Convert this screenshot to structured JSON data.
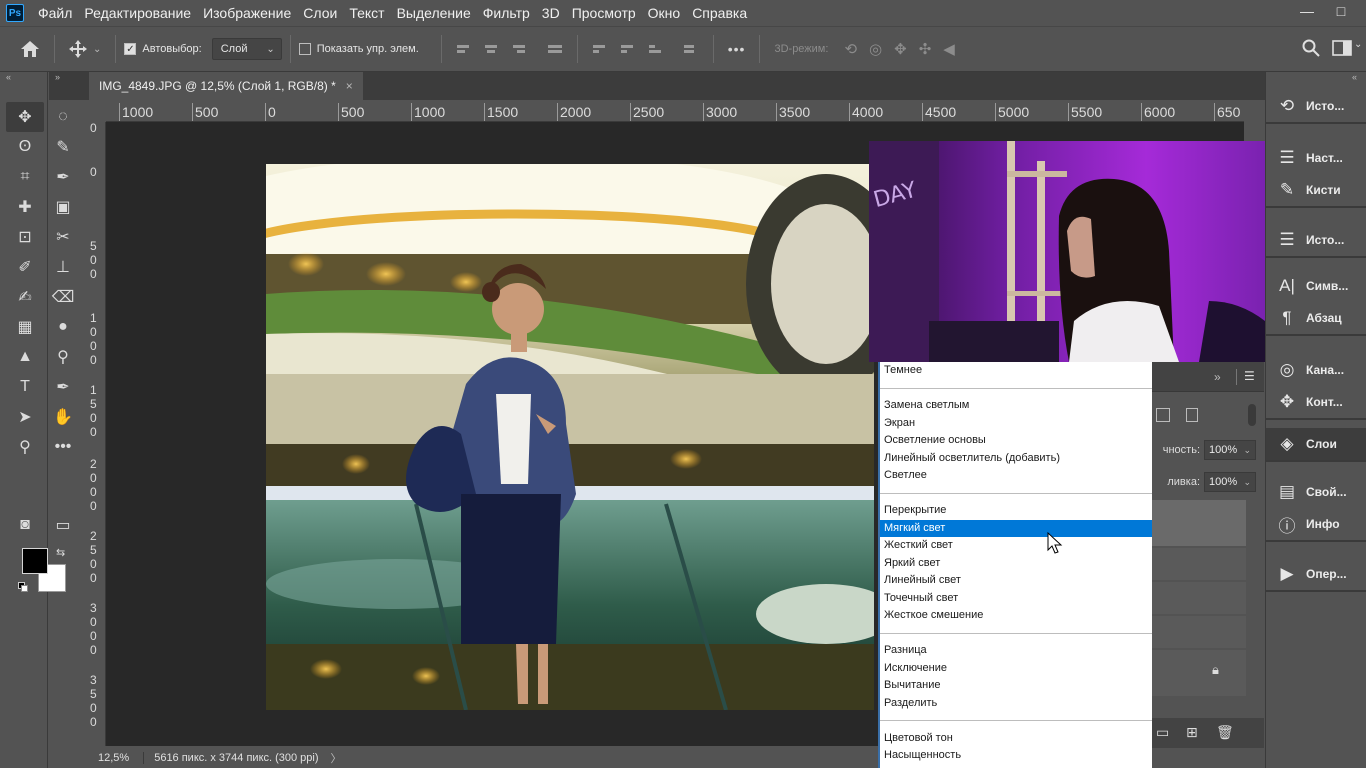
{
  "app": {
    "logo": "Ps"
  },
  "menu": [
    "Файл",
    "Редактирование",
    "Изображение",
    "Слои",
    "Текст",
    "Выделение",
    "Фильтр",
    "3D",
    "Просмотр",
    "Окно",
    "Справка"
  ],
  "window_controls": {
    "minimize": "—",
    "maximize": "□"
  },
  "options": {
    "autoselect_label": "Автовыбор:",
    "autoselect_value": "Слой",
    "show_controls_label": "Показать упр. элем.",
    "more": "•••",
    "mode_3d": "3D-режим:"
  },
  "document_tab": {
    "title": "IMG_4849.JPG @ 12,5% (Слой 1, RGB/8) *",
    "close": "×"
  },
  "ruler_top": [
    "1000",
    "500",
    "0",
    "500",
    "1000",
    "1500",
    "2000",
    "2500",
    "3000",
    "3500",
    "4000",
    "4500",
    "5000",
    "5500",
    "6000",
    "650"
  ],
  "ruler_left": [
    "0",
    "0",
    "5",
    "0",
    "0",
    "1",
    "0",
    "0",
    "0",
    "1",
    "5",
    "0",
    "0",
    "2",
    "0",
    "0",
    "0",
    "2",
    "5",
    "0",
    "0",
    "3",
    "0",
    "0",
    "0",
    "3",
    "5",
    "0",
    "0"
  ],
  "tools": {
    "left": [
      "move-tool",
      "lasso-tool",
      "crop-tool",
      "healing-tool",
      "transform-tool",
      "brush-tool",
      "history-brush-tool",
      "gradient-tool",
      "pen-path-tool",
      "type-tool",
      "path-select-tool",
      "zoom-tool",
      "quickmask-tool"
    ],
    "right": [
      "marquee-tool",
      "quick-select-tool",
      "eyedropper-tool",
      "bandage-tool",
      "scissors-tool",
      "stamp-tool",
      "eraser-tool",
      "blur-tool",
      "dodge-tool",
      "pen-tool",
      "hand-tool",
      "more-tools",
      "screen-mode-tool"
    ]
  },
  "blend_menu": {
    "items": [
      {
        "label": "Темнее"
      },
      {
        "sep": true
      },
      {
        "label": "Замена светлым"
      },
      {
        "label": "Экран"
      },
      {
        "label": "Осветление основы"
      },
      {
        "label": "Линейный осветлитель (добавить)"
      },
      {
        "label": "Светлее"
      },
      {
        "sep": true
      },
      {
        "label": "Перекрытие"
      },
      {
        "label": "Мягкий свет",
        "highlighted": true
      },
      {
        "label": "Жесткий свет"
      },
      {
        "label": "Яркий свет"
      },
      {
        "label": "Линейный свет"
      },
      {
        "label": "Точечный свет"
      },
      {
        "label": "Жесткое смешение"
      },
      {
        "sep": true
      },
      {
        "label": "Разница"
      },
      {
        "label": "Исключение"
      },
      {
        "label": "Вычитание"
      },
      {
        "label": "Разделить"
      },
      {
        "sep": true
      },
      {
        "label": "Цветовой тон"
      },
      {
        "label": "Насыщенность"
      }
    ]
  },
  "layers_panel": {
    "opacity_label": "чность:",
    "opacity_value": "100%",
    "fill_label": "ливка:",
    "fill_value": "100%"
  },
  "dock": [
    {
      "icon": "history-icon",
      "glyph": "⟲",
      "label": "Исто..."
    },
    {
      "icon": "adjustments-icon",
      "glyph": "☰",
      "label": "Наст..."
    },
    {
      "icon": "brushes-icon",
      "glyph": "✎",
      "label": "Кисти"
    },
    {
      "icon": "history2-icon",
      "glyph": "☰",
      "label": "Исто..."
    },
    {
      "icon": "character-icon",
      "glyph": "A|",
      "label": "Симв..."
    },
    {
      "icon": "paragraph-icon",
      "glyph": "¶",
      "label": "Абзац"
    },
    {
      "icon": "channels-icon",
      "glyph": "◎",
      "label": "Кана..."
    },
    {
      "icon": "paths-icon",
      "glyph": "✥",
      "label": "Конт..."
    },
    {
      "icon": "layers-icon",
      "glyph": "◈",
      "label": "Слои"
    },
    {
      "icon": "properties-icon",
      "glyph": "▤",
      "label": "Свой..."
    },
    {
      "icon": "info-icon",
      "glyph": "ⓘ",
      "label": "Инфо"
    },
    {
      "icon": "actions-icon",
      "glyph": "▶",
      "label": "Опер..."
    }
  ],
  "status": {
    "zoom": "12,5%",
    "info": "5616 пикс. x 3744 пикс. (300 ppi)",
    "arrow": "〉"
  }
}
